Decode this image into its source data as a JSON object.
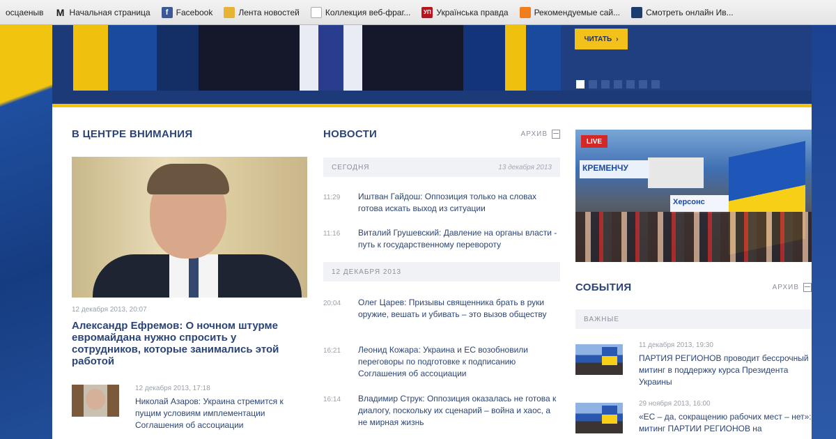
{
  "browser": {
    "bookmarks": [
      {
        "label": "осцаеныв",
        "icon": "none"
      },
      {
        "label": "Начальная страница",
        "icon": "m-logo-icon",
        "color": "#1a1a1a",
        "glyph": "M"
      },
      {
        "label": "Facebook",
        "icon": "facebook-icon",
        "color": "#3b5998",
        "glyph": "f"
      },
      {
        "label": "Лента новостей",
        "icon": "rss-folder-icon",
        "color": "#e7b335",
        "glyph": "▤"
      },
      {
        "label": "Коллекция веб-фраг...",
        "icon": "page-icon",
        "color": "#ffffff",
        "glyph": ""
      },
      {
        "label": "Українська правда",
        "icon": "up-logo-icon",
        "color": "#b8141b",
        "glyph": "УП"
      },
      {
        "label": "Рекомендуемые сай...",
        "icon": "shield-icon",
        "color": "#f27d1f",
        "glyph": "▼"
      },
      {
        "label": "Смотреть онлайн Ив...",
        "icon": "tv-icon",
        "color": "#1c3c72",
        "glyph": "▣"
      }
    ]
  },
  "hero": {
    "read_label": "ЧИТАТЬ",
    "read_arrow": "›",
    "slide_count": 7,
    "active_slide": 0
  },
  "focus": {
    "title": "В ЦЕНТРЕ ВНИМАНИЯ",
    "featured": {
      "date": "12 декабря 2013, 20:07",
      "headline": "Александр Ефремов: О ночном штурме евромайдана нужно спросить у сотрудников, которые занимались этой работой"
    },
    "secondary": {
      "date": "12 декабря 2013, 17:18",
      "text": "Николай Азаров: Украина стремится к пущим условиям имплементации Соглашения об ассоциации"
    }
  },
  "news": {
    "title": "НОВОСТИ",
    "archive_label": "АРХИВ",
    "day1": {
      "label": "СЕГОДНЯ",
      "date": "13 декабря 2013"
    },
    "day1_items": [
      {
        "time": "11:29",
        "text": "Иштван Гайдош: Оппозиция только на словах готова искать выход из ситуации"
      },
      {
        "time": "11:16",
        "text": "Виталий Грушевский: Давление на органы власти - путь к государственному перевороту"
      }
    ],
    "day2": {
      "label": "12 ДЕКАБРЯ 2013",
      "date": ""
    },
    "day2_items": [
      {
        "time": "20:04",
        "text": "Олег Царев: Призывы священника брать в руки оружие, вешать и убивать – это вызов обществу"
      },
      {
        "time": "16:21",
        "text": "Леонид Кожара: Украина и ЕС возобновили переговоры по подготовке к подписанию Соглашения об ассоциации"
      },
      {
        "time": "16:14",
        "text": "Владимир Струк: Оппозиция оказалась не готова к диалогу, поскольку их сценарий – война и хаос, а не мирная жизнь"
      }
    ]
  },
  "live": {
    "badge": "LIVE",
    "banner_city": "КРЕМЕНЧУ",
    "banner_city2": "Херсонс"
  },
  "events": {
    "title": "СОБЫТИЯ",
    "archive_label": "АРХИВ",
    "filter_label": "ВАЖНЫЕ",
    "items": [
      {
        "date": "11 декабря 2013, 19:30",
        "text": "ПАРТИЯ РЕГИОНОВ проводит бессрочный митинг в поддержку курса Президента Украины"
      },
      {
        "date": "29 ноября 2013, 16:00",
        "text": "«ЕС – да, сокращению рабочих мест – нет»: митинг ПАРТИИ РЕГИОНОВ на"
      }
    ]
  }
}
